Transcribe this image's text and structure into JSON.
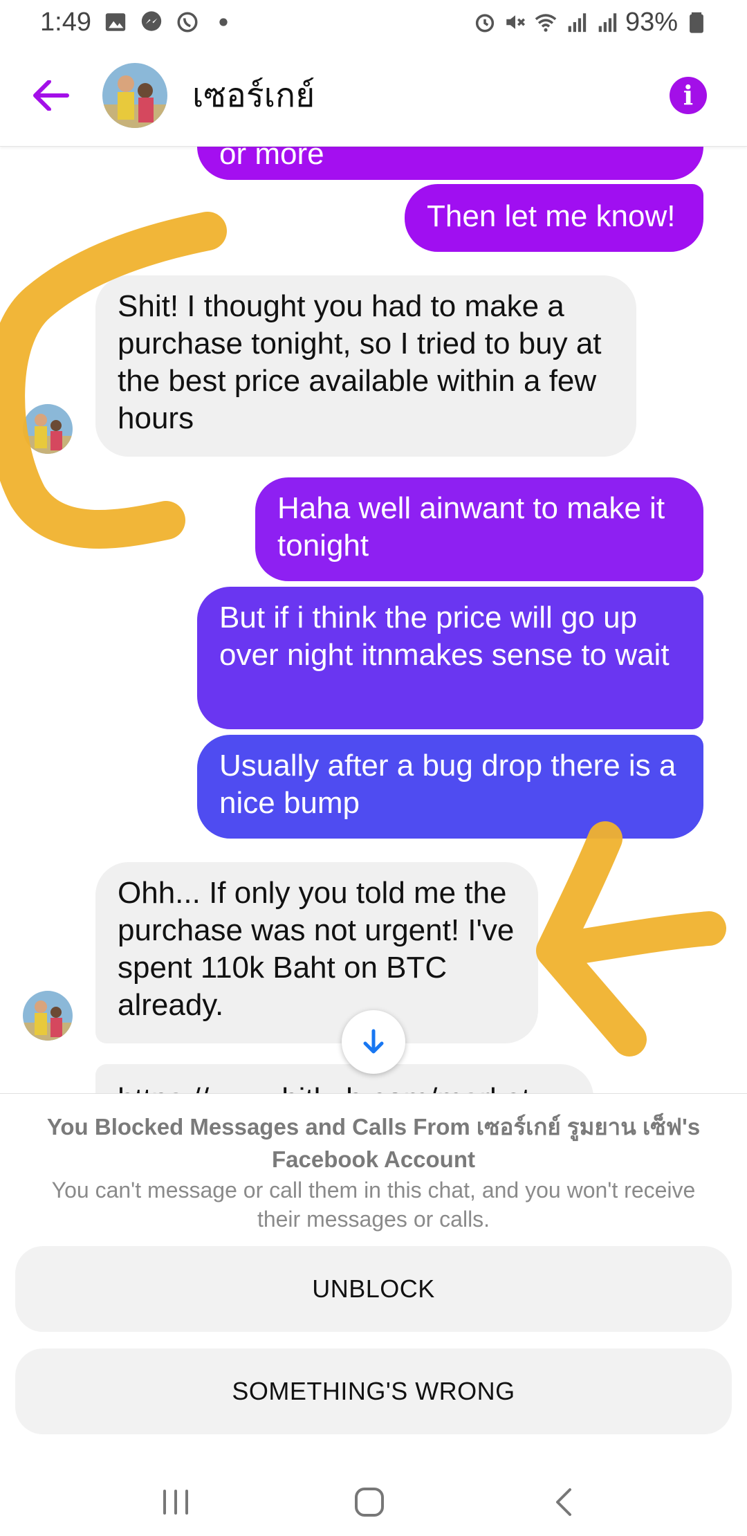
{
  "status_bar": {
    "time": "1:49",
    "battery": "93%",
    "left_icons": [
      "image-icon",
      "messenger-icon",
      "whatsapp-icon",
      "dot-icon"
    ],
    "right_icons": [
      "alarm-icon",
      "mute-icon",
      "wifi-icon",
      "signal-r-icon",
      "signal-r-icon"
    ]
  },
  "header": {
    "contact_name": "เซอร์เกย์",
    "accent_color": "#a30fe8"
  },
  "messages": [
    {
      "sender": "me",
      "text": "or more"
    },
    {
      "sender": "me",
      "text": "Then let me know!"
    },
    {
      "sender": "them",
      "text": "Shit! I thought you had to make a purchase tonight, so I tried to buy at the best price available within a few hours"
    },
    {
      "sender": "me",
      "text": "Haha well ainwant to make it tonight"
    },
    {
      "sender": "me",
      "text": "But if i think the price will go up over night itnmakes sense to wait"
    },
    {
      "sender": "me",
      "text": "Usually after a bug drop there is a nice bump"
    },
    {
      "sender": "them",
      "text": "Ohh... If only you told me the purchase was not urgent! I've spent 110k Baht on BTC already."
    },
    {
      "sender": "them",
      "text": "https://www.bitkub.com/market"
    }
  ],
  "blocked": {
    "title": "You Blocked Messages and Calls From เซอร์เกย์ รูมยาน เซ็ฟ's Facebook Account",
    "description": "You can't message or call them in this chat, and you won't receive their messages or calls.",
    "unblock_label": "UNBLOCK",
    "wrong_label": "SOMETHING'S WRONG"
  },
  "colors": {
    "bubble_out_top": "#a40ff0",
    "bubble_out_bottom": "#4a50f0",
    "bubble_in": "#f0f0f0",
    "annotation": "#f0b22e"
  }
}
